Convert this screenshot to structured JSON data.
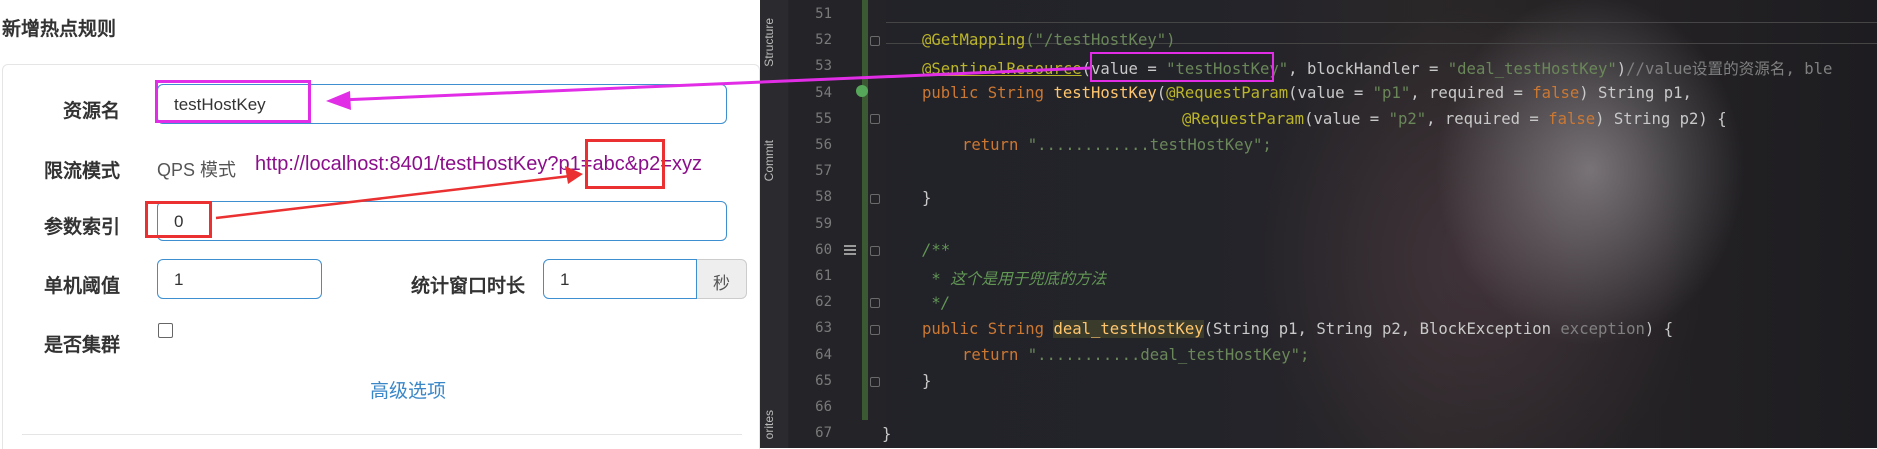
{
  "dialog": {
    "title": "新增热点规则",
    "fields": {
      "resource_label": "资源名",
      "resource_value": "testHostKey",
      "limit_mode_label": "限流模式",
      "limit_mode_value": "QPS 模式",
      "param_index_label": "参数索引",
      "param_index_value": "0",
      "threshold_label": "单机阈值",
      "threshold_value": "1",
      "window_label": "统计窗口时长",
      "window_value": "1",
      "window_unit": "秒",
      "cluster_label": "是否集群",
      "cluster_checked": false
    },
    "advanced_link": "高级选项"
  },
  "annotation": {
    "url": "http://localhost:8401/testHostKey?p1=abc&p2=xyz",
    "highlight_color": "#e12ee6",
    "arrow_color": "#ea3030"
  },
  "ide": {
    "side_tabs": [
      "Structure",
      "Commit",
      "orites"
    ],
    "line_numbers": [
      "51",
      "52",
      "53",
      "54",
      "55",
      "56",
      "57",
      "58",
      "59",
      "60",
      "61",
      "62",
      "63",
      "64",
      "65",
      "66",
      "67"
    ],
    "code": {
      "l52_ann": "@GetMapping",
      "l52_arg": "(\"/testHostKey\")",
      "l53_ann": "@SentinelResource",
      "l53_a": "(value = ",
      "l53_val": "\"testHostKey\"",
      "l53_b": ", blockHandler = ",
      "l53_bh": "\"deal_testHostKey\"",
      "l53_c": ")",
      "l53_cm": "//value设置的资源名, ble",
      "l54_a": "public String ",
      "l54_fn": "testHostKey",
      "l54_b": "(",
      "l54_rp": "@RequestParam",
      "l54_c": "(value = ",
      "l54_s": "\"p1\"",
      "l54_d": ", required = ",
      "l54_f": "false",
      "l54_e": ") String p1,",
      "l55_rp": "@RequestParam",
      "l55_c": "(value = ",
      "l55_s": "\"p2\"",
      "l55_d": ", required = ",
      "l55_f": "false",
      "l55_e": ") String p2) {",
      "l56_k": "return ",
      "l56_s": "\"............testHostKey\";",
      "l58": "}",
      "l60": "/**",
      "l61": " * 这个是用于兜底的方法",
      "l62": " */",
      "l63_a": "public String ",
      "l63_fn": "deal_testHostKey",
      "l63_b": "(String p1, String p2, BlockException ",
      "l63_ex": "exception",
      "l63_c": ") {",
      "l64_k": "return ",
      "l64_s": "\"...........deal_testHostKey\";",
      "l65": "}",
      "l67": "}"
    }
  }
}
